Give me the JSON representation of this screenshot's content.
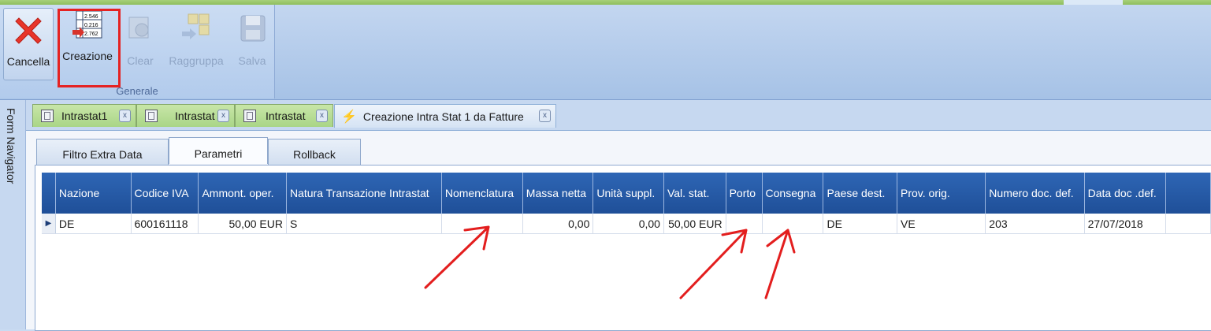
{
  "ribbon": {
    "group_label": "Generale",
    "buttons": {
      "cancel": "Cancella",
      "create": "Creazione",
      "clear": "Clear",
      "group": "Raggruppa",
      "save": "Salva"
    },
    "create_icon_numbers": [
      "2.546",
      "0.216",
      "2.762"
    ]
  },
  "side_nav": {
    "label": "Form Navigator"
  },
  "doc_tabs": [
    {
      "label": "Intrastat1",
      "close": "x"
    },
    {
      "label": "Intrastat",
      "close": "x"
    },
    {
      "label": "Intrastat",
      "close": "x"
    },
    {
      "label": "Creazione Intra Stat 1 da Fatture",
      "close": "x",
      "active": true
    }
  ],
  "sub_tabs": [
    {
      "label": "Filtro Extra Data"
    },
    {
      "label": "Parametri",
      "active": true
    },
    {
      "label": "Rollback"
    }
  ],
  "grid": {
    "columns": [
      "Nazione",
      "Codice IVA",
      "Ammont. oper.",
      "Natura Transazione Intrastat",
      "Nomenclatura",
      "Massa netta",
      "Unità suppl.",
      "Val. stat.",
      "Porto",
      "Consegna",
      "Paese dest.",
      "Prov. orig.",
      "Numero doc. def.",
      "Data doc .def."
    ],
    "rows": [
      [
        "DE",
        "600161118",
        "50,00 EUR",
        "S",
        "",
        "0,00",
        "0,00",
        "50,00 EUR",
        "",
        "",
        "DE",
        "VE",
        "203",
        "27/07/2018"
      ]
    ]
  },
  "colors": {
    "header_blue": "#2660ad",
    "highlight_red": "#e52222",
    "tab_green": "#b6dc93"
  }
}
